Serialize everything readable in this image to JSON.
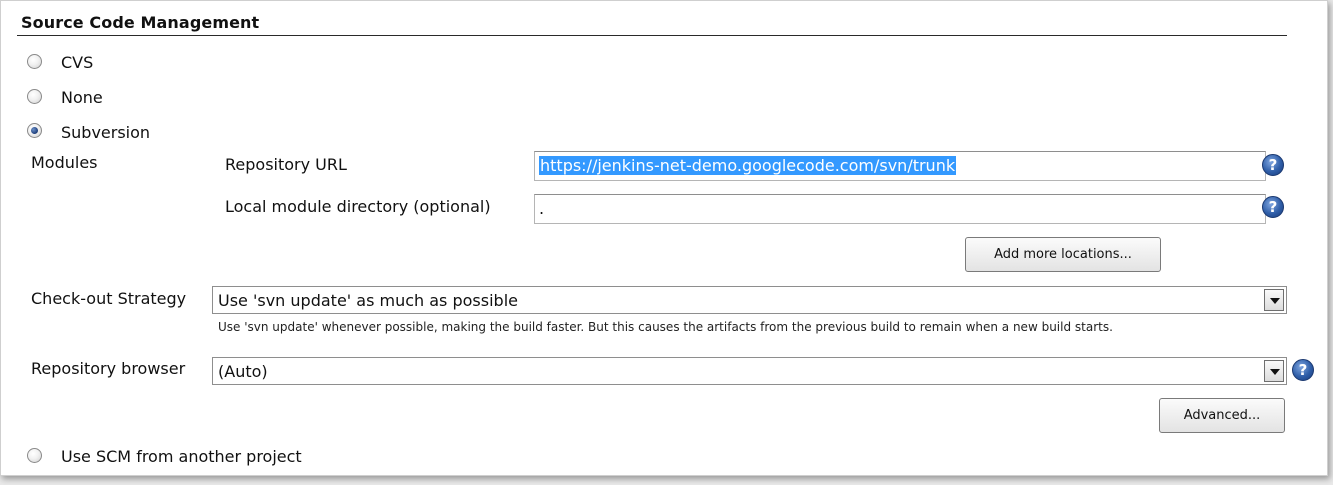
{
  "section": {
    "title": "Source Code Management"
  },
  "scm_options": [
    {
      "label": "CVS",
      "checked": false
    },
    {
      "label": "None",
      "checked": false
    },
    {
      "label": "Subversion",
      "checked": true
    }
  ],
  "modules": {
    "label": "Modules",
    "repository_url_label": "Repository URL",
    "repository_url_value": "https://jenkins-net-demo.googlecode.com/svn/trunk",
    "local_dir_label": "Local module directory (optional)",
    "local_dir_value": ".",
    "add_more_button": "Add more locations..."
  },
  "checkout": {
    "label": "Check-out Strategy",
    "selected": "Use 'svn update' as much as possible",
    "description": "Use 'svn update' whenever possible, making the build faster. But this causes the artifacts from the previous build to remain when a new build starts."
  },
  "repo_browser": {
    "label": "Repository browser",
    "selected": "(Auto)"
  },
  "advanced_button": "Advanced...",
  "other_scm": {
    "label": "Use SCM from another project",
    "checked": false
  },
  "icons": {
    "help": "?"
  },
  "colors": {
    "selection": "#3399ff",
    "help_icon": "#2f5ea8"
  }
}
